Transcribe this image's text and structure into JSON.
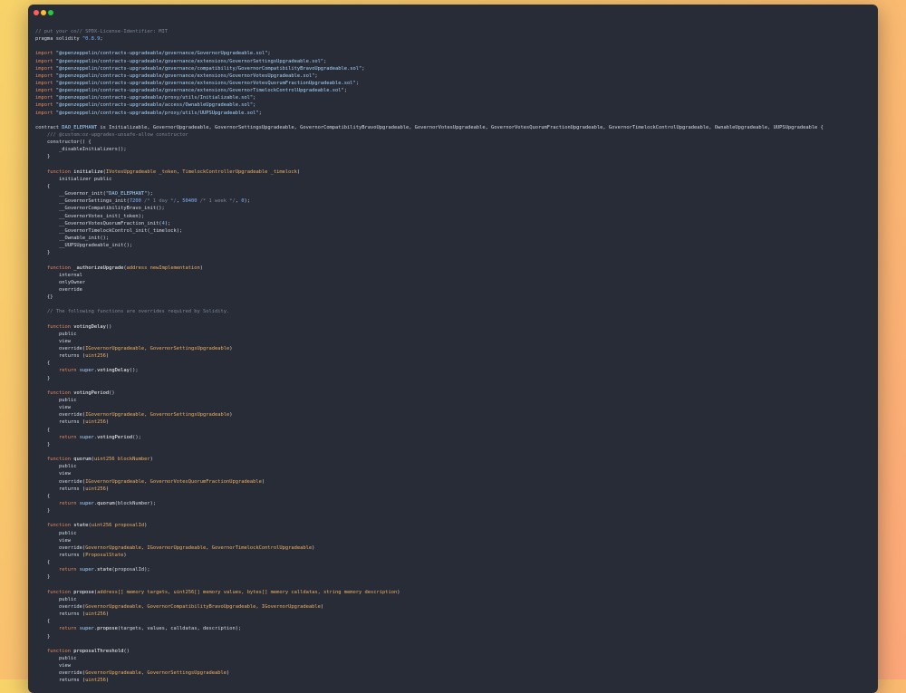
{
  "window": {
    "controls": [
      "close",
      "minimize",
      "maximize"
    ]
  },
  "colors": {
    "background_gradient": [
      "#f7d36a",
      "#fca679"
    ],
    "editor_bg": "#282c37",
    "keyword": "#e2895f",
    "string": "#a9d6ff",
    "comment": "#7c8594",
    "number": "#7fb3ff",
    "type": "#f0b061",
    "plain": "#d6dbe3"
  },
  "lines": [
    [
      [
        "comment",
        "// put your co// SPDX-License-Identifier: MIT"
      ]
    ],
    [
      [
        "plain",
        "pragma solidity "
      ],
      [
        "num",
        "^0.8.9"
      ],
      [
        "plain",
        ";"
      ]
    ],
    [],
    [
      [
        "kw",
        "import "
      ],
      [
        "str",
        "\"@openzeppelin/contracts-upgradeable/governance/GovernorUpgradeable.sol\""
      ],
      [
        "plain",
        ";"
      ]
    ],
    [
      [
        "kw",
        "import "
      ],
      [
        "str",
        "\"@openzeppelin/contracts-upgradeable/governance/extensions/GovernorSettingsUpgradeable.sol\""
      ],
      [
        "plain",
        ";"
      ]
    ],
    [
      [
        "kw",
        "import "
      ],
      [
        "str",
        "\"@openzeppelin/contracts-upgradeable/governance/compatibility/GovernorCompatibilityBravoUpgradeable.sol\""
      ],
      [
        "plain",
        ";"
      ]
    ],
    [
      [
        "kw",
        "import "
      ],
      [
        "str",
        "\"@openzeppelin/contracts-upgradeable/governance/extensions/GovernorVotesUpgradeable.sol\""
      ],
      [
        "plain",
        ";"
      ]
    ],
    [
      [
        "kw",
        "import "
      ],
      [
        "str",
        "\"@openzeppelin/contracts-upgradeable/governance/extensions/GovernorVotesQuorumFractionUpgradeable.sol\""
      ],
      [
        "plain",
        ";"
      ]
    ],
    [
      [
        "kw",
        "import "
      ],
      [
        "str",
        "\"@openzeppelin/contracts-upgradeable/governance/extensions/GovernorTimelockControlUpgradeable.sol\""
      ],
      [
        "plain",
        ";"
      ]
    ],
    [
      [
        "kw",
        "import "
      ],
      [
        "str",
        "\"@openzeppelin/contracts-upgradeable/proxy/utils/Initializable.sol\""
      ],
      [
        "plain",
        ";"
      ]
    ],
    [
      [
        "kw",
        "import "
      ],
      [
        "str",
        "\"@openzeppelin/contracts-upgradeable/access/OwnableUpgradeable.sol\""
      ],
      [
        "plain",
        ";"
      ]
    ],
    [
      [
        "kw",
        "import "
      ],
      [
        "str",
        "\"@openzeppelin/contracts-upgradeable/proxy/utils/UUPSUpgradeable.sol\""
      ],
      [
        "plain",
        ";"
      ]
    ],
    [],
    [
      [
        "plain",
        "contract "
      ],
      [
        "str",
        "DAO_ELEPHANT"
      ],
      [
        "plain",
        " is Initializable, GovernorUpgradeable, GovernorSettingsUpgradeable, GovernorCompatibilityBravoUpgradeable, GovernorVotesUpgradeable, GovernorVotesQuorumFractionUpgradeable, GovernorTimelockControlUpgradeable, OwnableUpgradeable, UUPSUpgradeable {"
      ]
    ],
    [
      [
        "comment",
        "    /// @custom:oz-upgrades-unsafe-allow constructor"
      ]
    ],
    [
      [
        "plain",
        "    constructor() {"
      ]
    ],
    [
      [
        "plain",
        "        _disableInitializers();"
      ]
    ],
    [
      [
        "plain",
        "    }"
      ]
    ],
    [],
    [
      [
        "kw",
        "    function "
      ],
      [
        "fn",
        "initialize"
      ],
      [
        "plain",
        "("
      ],
      [
        "type",
        "IVotesUpgradeable _token, TimelockControllerUpgradeable _timelock"
      ],
      [
        "plain",
        ")"
      ]
    ],
    [
      [
        "plain",
        "        initializer public"
      ]
    ],
    [
      [
        "plain",
        "    {"
      ]
    ],
    [
      [
        "plain",
        "        __Governor_init("
      ],
      [
        "str",
        "\"DAO_ELEPHANT\""
      ],
      [
        "plain",
        ");"
      ]
    ],
    [
      [
        "plain",
        "        __GovernorSettings_init("
      ],
      [
        "num",
        "7200"
      ],
      [
        "comment",
        " /* 1 day */"
      ],
      [
        "plain",
        ", "
      ],
      [
        "num",
        "50400"
      ],
      [
        "comment",
        " /* 1 week */"
      ],
      [
        "plain",
        ", "
      ],
      [
        "num",
        "0"
      ],
      [
        "plain",
        ");"
      ]
    ],
    [
      [
        "plain",
        "        __GovernorCompatibilityBravo_init();"
      ]
    ],
    [
      [
        "plain",
        "        __GovernorVotes_init(_token);"
      ]
    ],
    [
      [
        "plain",
        "        __GovernorVotesQuorumFraction_init("
      ],
      [
        "num",
        "4"
      ],
      [
        "plain",
        ");"
      ]
    ],
    [
      [
        "plain",
        "        __GovernorTimelockControl_init(_timelock);"
      ]
    ],
    [
      [
        "plain",
        "        __Ownable_init();"
      ]
    ],
    [
      [
        "plain",
        "        __UUPSUpgradeable_init();"
      ]
    ],
    [
      [
        "plain",
        "    }"
      ]
    ],
    [],
    [
      [
        "kw",
        "    function "
      ],
      [
        "fn",
        "_authorizeUpgrade"
      ],
      [
        "plain",
        "("
      ],
      [
        "type",
        "address newImplementation"
      ],
      [
        "plain",
        ")"
      ]
    ],
    [
      [
        "plain",
        "        internal"
      ]
    ],
    [
      [
        "plain",
        "        onlyOwner"
      ]
    ],
    [
      [
        "plain",
        "        override"
      ]
    ],
    [
      [
        "plain",
        "    {}"
      ]
    ],
    [],
    [
      [
        "comment",
        "    // The following functions are overrides required by Solidity."
      ]
    ],
    [],
    [
      [
        "kw",
        "    function "
      ],
      [
        "fn",
        "votingDelay"
      ],
      [
        "plain",
        "()"
      ]
    ],
    [
      [
        "plain",
        "        public"
      ]
    ],
    [
      [
        "plain",
        "        view"
      ]
    ],
    [
      [
        "plain",
        "        override("
      ],
      [
        "type",
        "IGovernorUpgradeable, GovernorSettingsUpgradeable"
      ],
      [
        "plain",
        ")"
      ]
    ],
    [
      [
        "plain",
        "        returns ("
      ],
      [
        "type",
        "uint256"
      ],
      [
        "plain",
        ")"
      ]
    ],
    [
      [
        "plain",
        "    {"
      ]
    ],
    [
      [
        "kw",
        "        return "
      ],
      [
        "str",
        "super"
      ],
      [
        "plain",
        "."
      ],
      [
        "fn",
        "votingDelay"
      ],
      [
        "plain",
        "();"
      ]
    ],
    [
      [
        "plain",
        "    }"
      ]
    ],
    [],
    [
      [
        "kw",
        "    function "
      ],
      [
        "fn",
        "votingPeriod"
      ],
      [
        "plain",
        "()"
      ]
    ],
    [
      [
        "plain",
        "        public"
      ]
    ],
    [
      [
        "plain",
        "        view"
      ]
    ],
    [
      [
        "plain",
        "        override("
      ],
      [
        "type",
        "IGovernorUpgradeable, GovernorSettingsUpgradeable"
      ],
      [
        "plain",
        ")"
      ]
    ],
    [
      [
        "plain",
        "        returns ("
      ],
      [
        "type",
        "uint256"
      ],
      [
        "plain",
        ")"
      ]
    ],
    [
      [
        "plain",
        "    {"
      ]
    ],
    [
      [
        "kw",
        "        return "
      ],
      [
        "str",
        "super"
      ],
      [
        "plain",
        "."
      ],
      [
        "fn",
        "votingPeriod"
      ],
      [
        "plain",
        "();"
      ]
    ],
    [
      [
        "plain",
        "    }"
      ]
    ],
    [],
    [
      [
        "kw",
        "    function "
      ],
      [
        "fn",
        "quorum"
      ],
      [
        "plain",
        "("
      ],
      [
        "type",
        "uint256 blockNumber"
      ],
      [
        "plain",
        ")"
      ]
    ],
    [
      [
        "plain",
        "        public"
      ]
    ],
    [
      [
        "plain",
        "        view"
      ]
    ],
    [
      [
        "plain",
        "        override("
      ],
      [
        "type",
        "IGovernorUpgradeable, GovernorVotesQuorumFractionUpgradeable"
      ],
      [
        "plain",
        ")"
      ]
    ],
    [
      [
        "plain",
        "        returns ("
      ],
      [
        "type",
        "uint256"
      ],
      [
        "plain",
        ")"
      ]
    ],
    [
      [
        "plain",
        "    {"
      ]
    ],
    [
      [
        "kw",
        "        return "
      ],
      [
        "str",
        "super"
      ],
      [
        "plain",
        "."
      ],
      [
        "fn",
        "quorum"
      ],
      [
        "plain",
        "(blockNumber);"
      ]
    ],
    [
      [
        "plain",
        "    }"
      ]
    ],
    [],
    [
      [
        "kw",
        "    function "
      ],
      [
        "fn",
        "state"
      ],
      [
        "plain",
        "("
      ],
      [
        "type",
        "uint256 proposalId"
      ],
      [
        "plain",
        ")"
      ]
    ],
    [
      [
        "plain",
        "        public"
      ]
    ],
    [
      [
        "plain",
        "        view"
      ]
    ],
    [
      [
        "plain",
        "        override("
      ],
      [
        "type",
        "GovernorUpgradeable, IGovernorUpgradeable, GovernorTimelockControlUpgradeable"
      ],
      [
        "plain",
        ")"
      ]
    ],
    [
      [
        "plain",
        "        returns ("
      ],
      [
        "type",
        "ProposalState"
      ],
      [
        "plain",
        ")"
      ]
    ],
    [
      [
        "plain",
        "    {"
      ]
    ],
    [
      [
        "kw",
        "        return "
      ],
      [
        "str",
        "super"
      ],
      [
        "plain",
        "."
      ],
      [
        "fn",
        "state"
      ],
      [
        "plain",
        "(proposalId);"
      ]
    ],
    [
      [
        "plain",
        "    }"
      ]
    ],
    [],
    [
      [
        "kw",
        "    function "
      ],
      [
        "fn",
        "propose"
      ],
      [
        "plain",
        "("
      ],
      [
        "type",
        "address[] memory targets, uint256[] memory values, bytes[] memory calldatas, string memory description"
      ],
      [
        "plain",
        ")"
      ]
    ],
    [
      [
        "plain",
        "        public"
      ]
    ],
    [
      [
        "plain",
        "        override("
      ],
      [
        "type",
        "GovernorUpgradeable, GovernorCompatibilityBravoUpgradeable, IGovernorUpgradeable"
      ],
      [
        "plain",
        ")"
      ]
    ],
    [
      [
        "plain",
        "        returns ("
      ],
      [
        "type",
        "uint256"
      ],
      [
        "plain",
        ")"
      ]
    ],
    [
      [
        "plain",
        "    {"
      ]
    ],
    [
      [
        "kw",
        "        return "
      ],
      [
        "str",
        "super"
      ],
      [
        "plain",
        "."
      ],
      [
        "fn",
        "propose"
      ],
      [
        "plain",
        "(targets, values, calldatas, description);"
      ]
    ],
    [
      [
        "plain",
        "    }"
      ]
    ],
    [],
    [
      [
        "kw",
        "    function "
      ],
      [
        "fn",
        "proposalThreshold"
      ],
      [
        "plain",
        "()"
      ]
    ],
    [
      [
        "plain",
        "        public"
      ]
    ],
    [
      [
        "plain",
        "        view"
      ]
    ],
    [
      [
        "plain",
        "        override("
      ],
      [
        "type",
        "GovernorUpgradeable, GovernorSettingsUpgradeable"
      ],
      [
        "plain",
        ")"
      ]
    ],
    [
      [
        "plain",
        "        returns ("
      ],
      [
        "type",
        "uint256"
      ],
      [
        "plain",
        ")"
      ]
    ]
  ]
}
